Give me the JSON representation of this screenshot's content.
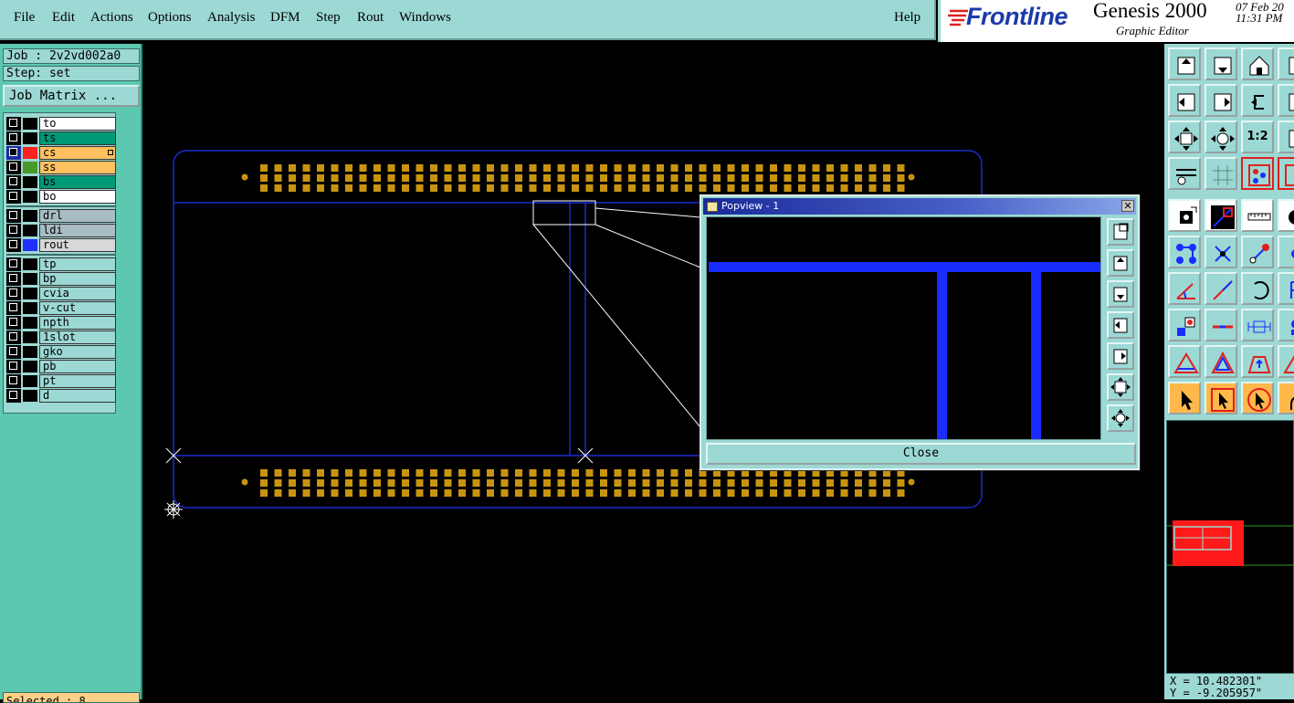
{
  "menubar": {
    "items": [
      "File",
      "Edit",
      "Actions",
      "Options",
      "Analysis",
      "DFM",
      "Step",
      "Rout",
      "Windows"
    ],
    "help": "Help"
  },
  "brand": {
    "logo_text": "Frontline",
    "product": "Genesis 2000",
    "subtitle": "Graphic Editor",
    "date": "07 Feb 20",
    "time": "11:31 PM"
  },
  "left": {
    "job": "Job : 2v2vd002a0",
    "step": "Step: set",
    "job_matrix": "Job Matrix ...",
    "selected": "Selected : 8"
  },
  "layers": [
    {
      "name": "to",
      "color": "#ffffff",
      "swatch": "#000000",
      "group": 1
    },
    {
      "name": "ts",
      "color": "#009978",
      "swatch": "#000000",
      "group": 1
    },
    {
      "name": "cs",
      "color": "#ffc060",
      "swatch": "#ff2020",
      "group": 1,
      "active": true
    },
    {
      "name": "ss",
      "color": "#ffc060",
      "swatch": "#4a9a2a",
      "group": 1
    },
    {
      "name": "bs",
      "color": "#009978",
      "swatch": "#000000",
      "group": 1
    },
    {
      "name": "bo",
      "color": "#ffffff",
      "swatch": "#000000",
      "group": 1
    },
    {
      "name": "drl",
      "color": "#a8bcc4",
      "swatch": "#000000",
      "group": 2
    },
    {
      "name": "ldi",
      "color": "#a8bcc4",
      "swatch": "#000000",
      "group": 2
    },
    {
      "name": "rout",
      "color": "#d8d8d8",
      "swatch": "#2030ff",
      "group": 2
    },
    {
      "name": "tp",
      "color": "#9cd8d4",
      "swatch": "#000000",
      "group": 3
    },
    {
      "name": "bp",
      "color": "#9cd8d4",
      "swatch": "#000000",
      "group": 3
    },
    {
      "name": "cvia",
      "color": "#9cd8d4",
      "swatch": "#000000",
      "group": 3
    },
    {
      "name": "v-cut",
      "color": "#9cd8d4",
      "swatch": "#000000",
      "group": 3
    },
    {
      "name": "npth",
      "color": "#9cd8d4",
      "swatch": "#000000",
      "group": 3
    },
    {
      "name": "1slot",
      "color": "#9cd8d4",
      "swatch": "#000000",
      "group": 3
    },
    {
      "name": "gko",
      "color": "#9cd8d4",
      "swatch": "#000000",
      "group": 3
    },
    {
      "name": "pb",
      "color": "#9cd8d4",
      "swatch": "#000000",
      "group": 3
    },
    {
      "name": "pt",
      "color": "#9cd8d4",
      "swatch": "#000000",
      "group": 3
    },
    {
      "name": "d",
      "color": "#9cd8d4",
      "swatch": "#000000",
      "group": 3
    }
  ],
  "popview": {
    "title": "Popview - 1",
    "close_x": "✕",
    "close_button": "Close"
  },
  "toolbar": {
    "rows": [
      [
        "display-top-icon",
        "display-bottom-icon",
        "home-icon",
        "page-icon"
      ],
      [
        "zoom-in-left-icon",
        "zoom-right-icon",
        "undo-view-icon",
        "page2-icon"
      ],
      [
        "fit-all-icon",
        "fit-profile-icon",
        "scale-1-2-icon",
        "page3-icon"
      ],
      [
        "snap-settings-icon",
        "grid-icon",
        "layers-display-icon",
        "layers2-icon"
      ],
      [
        "pad-select-icon",
        "line-add-icon",
        "measure-ruler-icon",
        "circle-icon"
      ],
      [
        "net-connect-icon",
        "delete-point-icon",
        "move-point-icon",
        "dot-icon"
      ],
      [
        "angle-icon",
        "slash-line-icon",
        "arc-rotate-icon",
        "bracket-icon"
      ],
      [
        "resize-icon",
        "center-line-icon",
        "dimension-icon",
        "misc-icon"
      ],
      [
        "triangle-warn-icon",
        "polygon-edit-icon",
        "polygon-fill-icon",
        "polygon2-icon"
      ],
      [
        "pointer-select-icon",
        "pointer-box-icon",
        "pointer-circle-icon",
        "pointer-misc-icon"
      ]
    ],
    "scale_label": "1:2"
  },
  "colors": {
    "profile_blue": "#1a2ad0",
    "pad_gold": "#c89410",
    "trace_blue": "#1a2cff",
    "panel_teal": "#9cd8d4",
    "side_teal": "#5cc8b0"
  },
  "coords": {
    "x": "X = 10.482301\"",
    "y": "Y = -9.205957\""
  }
}
